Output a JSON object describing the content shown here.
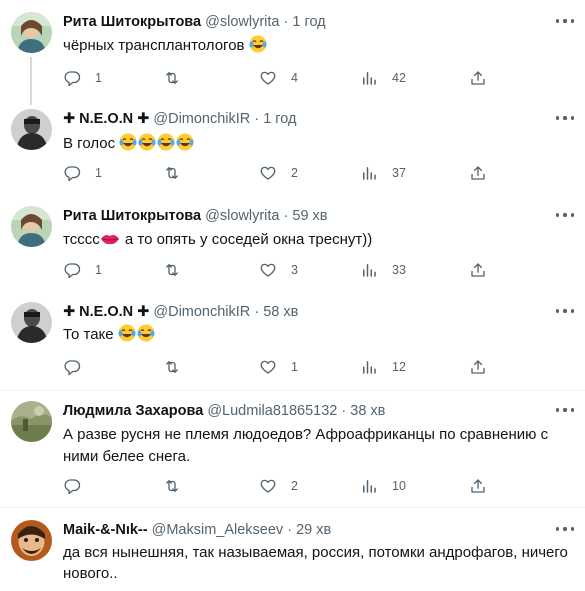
{
  "tweets": [
    {
      "name": "Рита Шитокрытова",
      "handle": "@slowlyrita",
      "time": "1 год",
      "text": "чёрных трансплантологов",
      "emoji": [
        "laugh-cry"
      ],
      "replies": "1",
      "retweets": "",
      "likes": "4",
      "views": "42"
    },
    {
      "name": "✚ N.E.O.N ✚",
      "handle": "@DimonchikIR",
      "time": "1 год",
      "text": "В голос",
      "emoji": [
        "laugh-cry",
        "laugh-cry",
        "laugh-cry",
        "laugh-cry"
      ],
      "replies": "1",
      "retweets": "",
      "likes": "2",
      "views": "37"
    },
    {
      "name": "Рита Шитокрытова",
      "handle": "@slowlyrita",
      "time": "59 хв",
      "text_before": "тсссс",
      "text_after": " а то опять у соседей окна треснут))",
      "emoji": [
        "kiss-lips"
      ],
      "replies": "1",
      "retweets": "",
      "likes": "3",
      "views": "33"
    },
    {
      "name": "✚ N.E.O.N ✚",
      "handle": "@DimonchikIR",
      "time": "58 хв",
      "text": "То таке",
      "emoji": [
        "laugh-cry",
        "laugh-cry"
      ],
      "replies": "",
      "retweets": "",
      "likes": "1",
      "views": "12"
    },
    {
      "name": "Людмила Захарова",
      "handle": "@Ludmila81865132",
      "time": "38 хв",
      "text": "А разве русня не племя людоедов?  Афроафриканцы по сравнению с ними белее снега.",
      "replies": "",
      "retweets": "",
      "likes": "2",
      "views": "10"
    },
    {
      "name": "Maik-&-Nık--",
      "handle": "@Maksim_Alekseev",
      "time": "29 хв",
      "text": "да вся нынешняя, так называемая, россия, потомки андрофагов, ничего нового..",
      "replies": "",
      "retweets": "",
      "likes": "",
      "views": ""
    }
  ],
  "separator": "·",
  "icons": {
    "reply": "reply-icon",
    "retweet": "retweet-icon",
    "like": "like-icon",
    "views": "views-icon",
    "share": "share-icon",
    "more": "more-icon"
  },
  "colors": {
    "text": "#0f1419",
    "secondary": "#536471",
    "divider": "#eff3f4",
    "thread_line": "#cfd9de"
  }
}
